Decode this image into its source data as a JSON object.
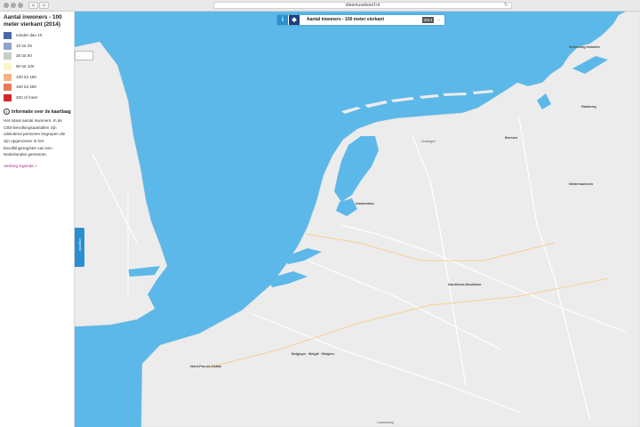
{
  "browser": {
    "url": "ideemuseboerf.nl",
    "back_label": "<",
    "forward_label": ">",
    "reload_icon": "reload-icon"
  },
  "legend": {
    "title": "Aantal inwoners - 100 meter vierkant (2014)",
    "classes": [
      {
        "label": "minder dan 10",
        "color": "#4a67a8"
      },
      {
        "label": "10 tot 25",
        "color": "#8fa4cf"
      },
      {
        "label": "25 tot 50",
        "color": "#c4d0c4"
      },
      {
        "label": "50 tot 100",
        "color": "#fbf6c3"
      },
      {
        "label": "100 tot 150",
        "color": "#f5b487"
      },
      {
        "label": "150 tot 250",
        "color": "#e97a5a"
      },
      {
        "label": "250 of meer",
        "color": "#d2262b"
      }
    ],
    "info_heading": "Informatie over de kaartlaag",
    "info_text": "Het totaal aantal inwoners. In de CBS-bevolkingsaantallen zijn uitsluitend personen begrepen die zijn opgenomen in het bevolkingsregister van een Nederlandse gemeente.",
    "hide_link": "Verberg legenda >"
  },
  "toolbar": {
    "info_icon": "info-icon",
    "layers_icon": "layers-icon",
    "title": "Aantal inwoners - 100 meter vierkant",
    "year": "2014",
    "caret": "⌄"
  },
  "legend_tab": {
    "label": "Legenda"
  },
  "map": {
    "sea_color": "#5cb8e8",
    "land_color": "#ececec",
    "places": [
      {
        "name": "Schleswig-Holstein"
      },
      {
        "name": "Hamburg"
      },
      {
        "name": "Bremen"
      },
      {
        "name": "Niedersachsen"
      },
      {
        "name": "Groningen"
      },
      {
        "name": "Amsterdam"
      },
      {
        "name": "Nordrhein-Westfalen"
      },
      {
        "name": "Belgique · België · Belgien"
      },
      {
        "name": "Nord-Pas-de-Calais"
      },
      {
        "name": "Luxembourg"
      }
    ]
  }
}
